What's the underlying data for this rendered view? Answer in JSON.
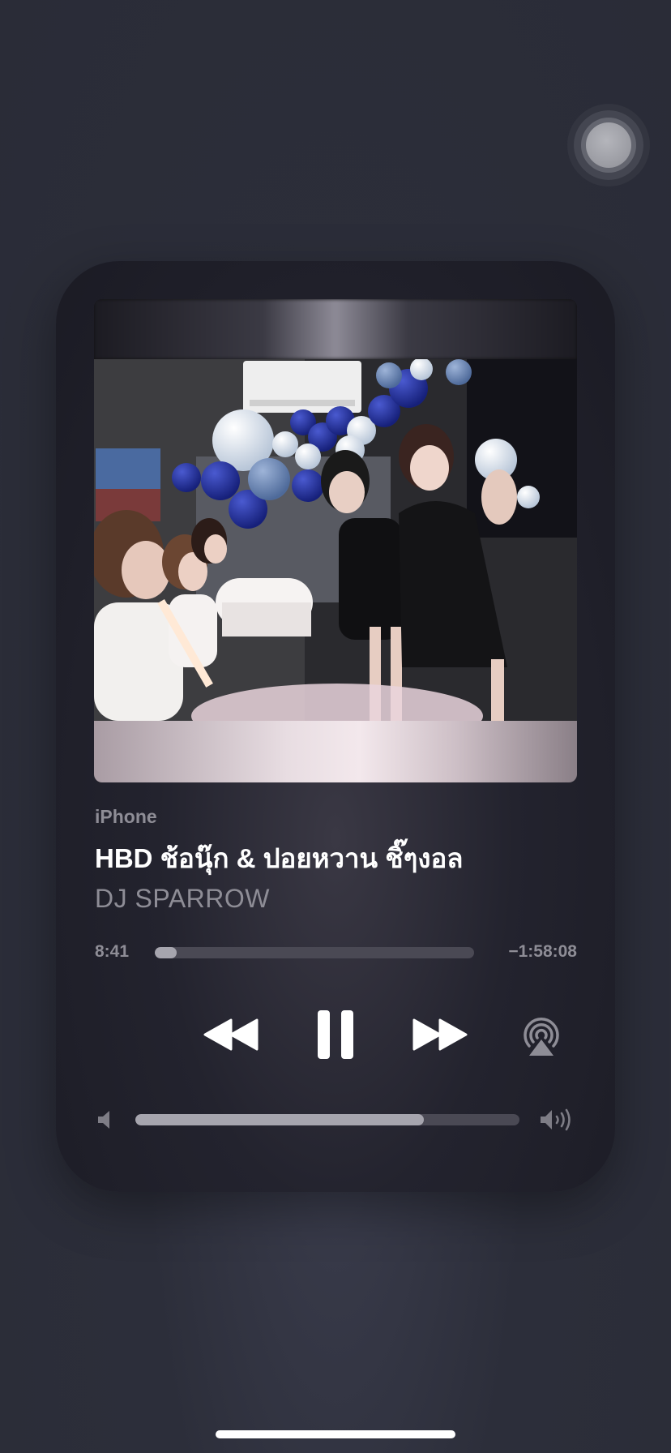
{
  "now_playing": {
    "source": "iPhone",
    "title": "HBD ช้อนุ๊ก & ปอยหวาน ชิ๊ๆงอล",
    "artist": "DJ SPARROW",
    "elapsed": "8:41",
    "remaining": "−1:58:08",
    "progress_fraction": 0.068,
    "volume_fraction": 0.75,
    "state": "playing"
  },
  "controls": {
    "rewind_icon": "rewind-icon",
    "pause_icon": "pause-icon",
    "forward_icon": "fast-forward-icon",
    "airplay_icon": "airplay-audio-icon",
    "volume_low_icon": "speaker-low-icon",
    "volume_high_icon": "speaker-high-icon"
  },
  "colors": {
    "background": "#2c2e3a",
    "card": "#1f1f29",
    "primary_text": "#ffffff",
    "secondary_text": "#8e8d96",
    "track": "#4a4954",
    "fill": "#a6a5ae"
  }
}
